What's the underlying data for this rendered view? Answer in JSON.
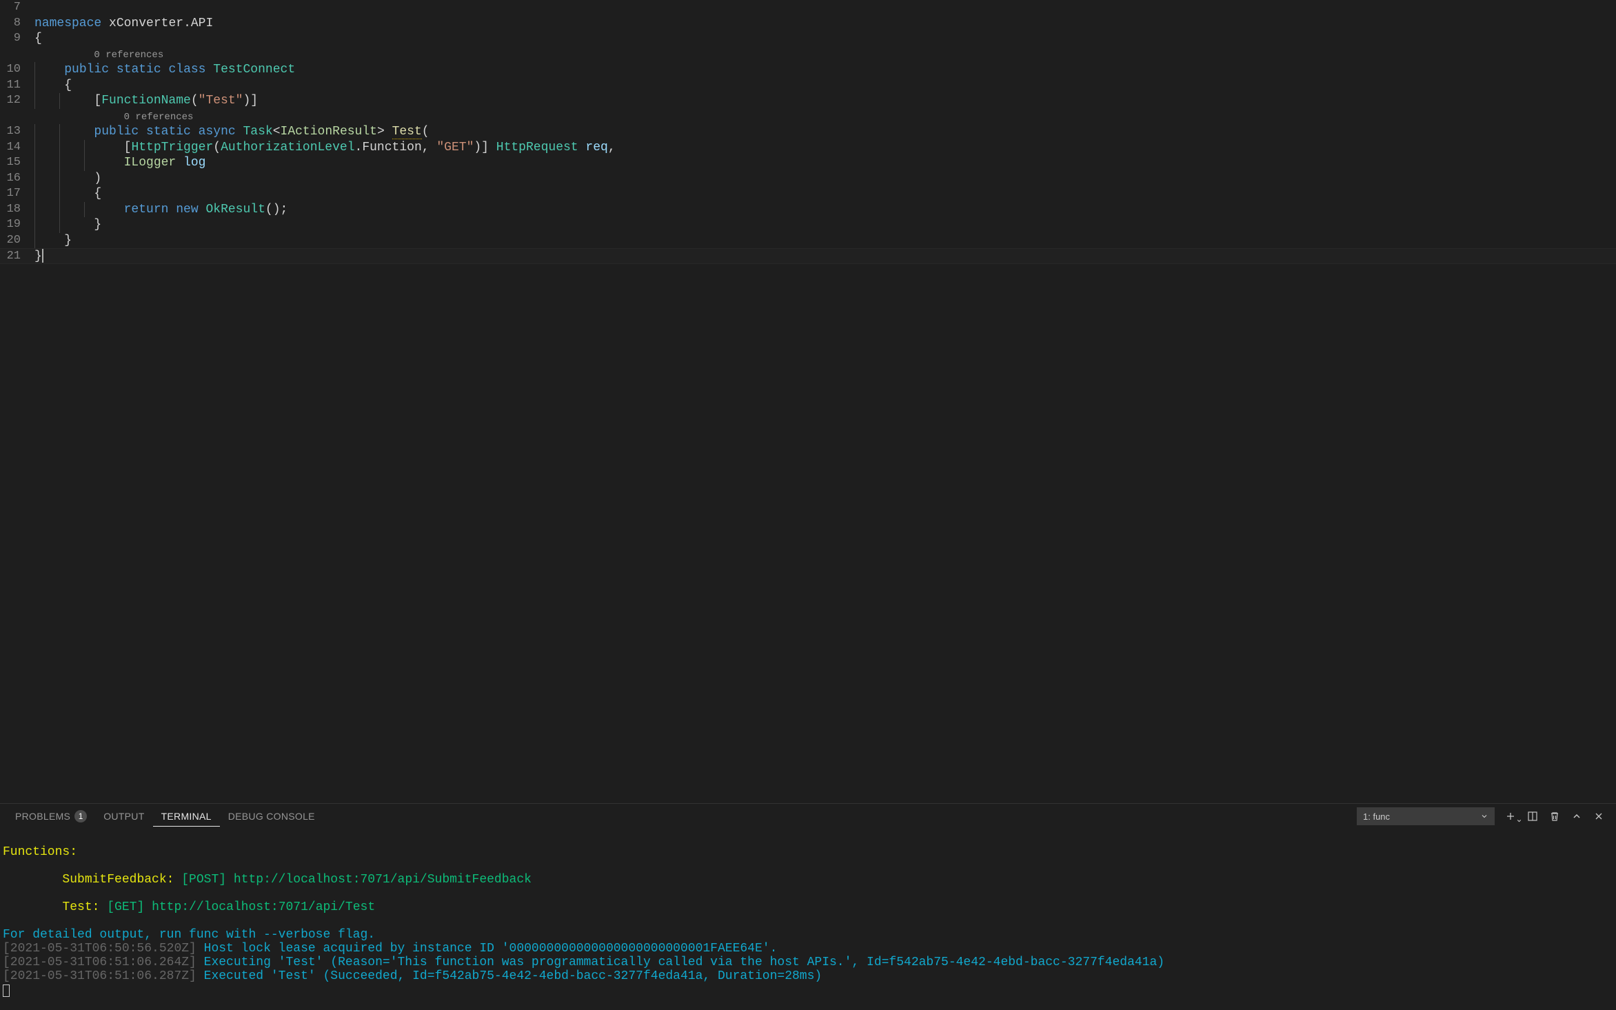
{
  "editor": {
    "lines": [
      {
        "num": "7",
        "code": []
      },
      {
        "num": "8",
        "code": [
          {
            "t": "namespace",
            "c": "tok-keyword"
          },
          {
            "t": " ",
            "c": "tok-plain"
          },
          {
            "t": "xConverter",
            "c": "tok-plain"
          },
          {
            "t": ".",
            "c": "tok-punct"
          },
          {
            "t": "API",
            "c": "tok-plain"
          }
        ]
      },
      {
        "num": "9",
        "code": [
          {
            "t": "{",
            "c": "tok-punct"
          }
        ],
        "current": true,
        "indent_guides": 0
      },
      {
        "codelens": true,
        "indent": "        ",
        "text": "0 references"
      },
      {
        "num": "10",
        "code": [
          {
            "t": "    ",
            "c": ""
          },
          {
            "t": "public",
            "c": "tok-keyword"
          },
          {
            "t": " ",
            "c": ""
          },
          {
            "t": "static",
            "c": "tok-keyword"
          },
          {
            "t": " ",
            "c": ""
          },
          {
            "t": "class",
            "c": "tok-keyword"
          },
          {
            "t": " ",
            "c": ""
          },
          {
            "t": "TestConnect",
            "c": "tok-class"
          }
        ],
        "guides": [
          0
        ]
      },
      {
        "num": "11",
        "code": [
          {
            "t": "    {",
            "c": "tok-punct"
          }
        ],
        "guides": [
          0
        ]
      },
      {
        "num": "12",
        "code": [
          {
            "t": "        [",
            "c": "tok-punct"
          },
          {
            "t": "FunctionName",
            "c": "tok-class"
          },
          {
            "t": "(",
            "c": "tok-punct"
          },
          {
            "t": "\"Test\"",
            "c": "tok-string"
          },
          {
            "t": ")]",
            "c": "tok-punct"
          }
        ],
        "guides": [
          0,
          4
        ]
      },
      {
        "codelens": true,
        "indent": "            ",
        "text": "0 references"
      },
      {
        "num": "13",
        "code": [
          {
            "t": "        ",
            "c": ""
          },
          {
            "t": "public",
            "c": "tok-keyword"
          },
          {
            "t": " ",
            "c": ""
          },
          {
            "t": "static",
            "c": "tok-keyword"
          },
          {
            "t": " ",
            "c": ""
          },
          {
            "t": "async",
            "c": "tok-keyword"
          },
          {
            "t": " ",
            "c": ""
          },
          {
            "t": "Task",
            "c": "tok-class"
          },
          {
            "t": "<",
            "c": "tok-punct"
          },
          {
            "t": "IActionResult",
            "c": "tok-interface"
          },
          {
            "t": "> ",
            "c": "tok-punct"
          },
          {
            "t": "Test",
            "c": "tok-method underline-squiggle"
          },
          {
            "t": "(",
            "c": "tok-punct"
          }
        ],
        "guides": [
          0,
          4
        ]
      },
      {
        "num": "14",
        "code": [
          {
            "t": "            [",
            "c": "tok-punct"
          },
          {
            "t": "HttpTrigger",
            "c": "tok-class"
          },
          {
            "t": "(",
            "c": "tok-punct"
          },
          {
            "t": "AuthorizationLevel",
            "c": "tok-type"
          },
          {
            "t": ".",
            "c": "tok-punct"
          },
          {
            "t": "Function",
            "c": "tok-plain"
          },
          {
            "t": ", ",
            "c": "tok-punct"
          },
          {
            "t": "\"GET\"",
            "c": "tok-string"
          },
          {
            "t": ")] ",
            "c": "tok-punct"
          },
          {
            "t": "HttpRequest",
            "c": "tok-class"
          },
          {
            "t": " ",
            "c": ""
          },
          {
            "t": "req",
            "c": "tok-var"
          },
          {
            "t": ",",
            "c": "tok-punct"
          }
        ],
        "guides": [
          0,
          4,
          8
        ]
      },
      {
        "num": "15",
        "code": [
          {
            "t": "            ",
            "c": ""
          },
          {
            "t": "ILogger",
            "c": "tok-interface"
          },
          {
            "t": " ",
            "c": ""
          },
          {
            "t": "log",
            "c": "tok-var"
          }
        ],
        "guides": [
          0,
          4,
          8
        ]
      },
      {
        "num": "16",
        "code": [
          {
            "t": "        )",
            "c": "tok-punct"
          }
        ],
        "guides": [
          0,
          4
        ]
      },
      {
        "num": "17",
        "code": [
          {
            "t": "        {",
            "c": "tok-punct"
          }
        ],
        "guides": [
          0,
          4
        ]
      },
      {
        "num": "18",
        "code": [
          {
            "t": "            ",
            "c": ""
          },
          {
            "t": "return",
            "c": "tok-keyword"
          },
          {
            "t": " ",
            "c": ""
          },
          {
            "t": "new",
            "c": "tok-keyword"
          },
          {
            "t": " ",
            "c": ""
          },
          {
            "t": "OkResult",
            "c": "tok-class"
          },
          {
            "t": "();",
            "c": "tok-punct"
          }
        ],
        "guides": [
          0,
          4,
          8
        ]
      },
      {
        "num": "19",
        "code": [
          {
            "t": "        }",
            "c": "tok-punct"
          }
        ],
        "guides": [
          0,
          4
        ]
      },
      {
        "num": "20",
        "code": [
          {
            "t": "    }",
            "c": "tok-punct"
          }
        ],
        "guides": [
          0
        ]
      },
      {
        "num": "21",
        "code": [
          {
            "t": "}",
            "c": "tok-punct"
          }
        ],
        "guides": []
      }
    ]
  },
  "panel": {
    "tabs": {
      "problems": "PROBLEMS",
      "problems_count": "1",
      "output": "OUTPUT",
      "terminal": "TERMINAL",
      "debug_console": "DEBUG CONSOLE"
    },
    "terminal_selector": "1: func",
    "terminal": {
      "l_functions_header": "Functions:",
      "l_submit_label": "        SubmitFeedback:",
      "l_submit_method": " [POST] ",
      "l_submit_url": "http://localhost:7071/api/SubmitFeedback",
      "l_test_label": "        Test:",
      "l_test_method": " [GET] ",
      "l_test_url": "http://localhost:7071/api/Test",
      "l_verbose": "For detailed output, run func with --verbose flag.",
      "l_ts1": "[2021-05-31T06:50:56.520Z] ",
      "l_msg1": "Host lock lease acquired by instance ID '000000000000000000000000001FAEE64E'.",
      "l_ts2": "[2021-05-31T06:51:06.264Z] ",
      "l_msg2a": "Executing 'Test' (Reason='This function was programmatically called via the host APIs.', Id=f542ab75-4e42-4ebd-bacc-3277f4eda41a)",
      "l_ts3": "[2021-05-31T06:51:06.287Z] ",
      "l_msg3": "Executed 'Test' (Succeeded, Id=f542ab75-4e42-4ebd-bacc-3277f4eda41a, Duration=28ms)"
    }
  }
}
